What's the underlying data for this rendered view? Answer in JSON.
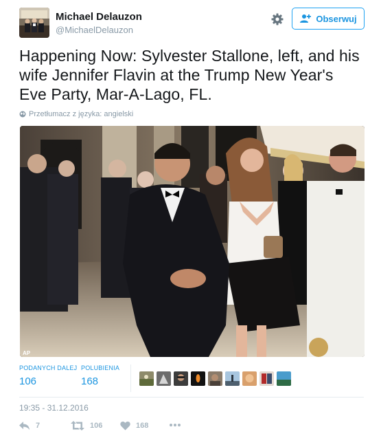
{
  "user": {
    "name": "Michael Delauzon",
    "handle": "@MichaelDelauzon",
    "avatar_icon": "avatar-photo"
  },
  "header": {
    "follow_label": "Obserwuj",
    "follow_icon": "add-user-icon",
    "settings_icon": "gear-icon"
  },
  "tweet": {
    "text": "Happening Now: Sylvester Stallone, left, and his wife Jennifer Flavin at the Trump New Year's Eve Party, Mar-A-Lago, FL.",
    "translate_label": "Przetłumacz z języka: angielski",
    "photo_credit": "AP"
  },
  "stats": {
    "retweets_label": "PODANYCH DALEJ",
    "retweets_value": "106",
    "likes_label": "POLUBIENIA",
    "likes_value": "168",
    "liker_count_shown": 9
  },
  "timestamp": "19:35 - 31.12.2016",
  "actions": {
    "reply_count": "7",
    "retweet_count": "106",
    "like_count": "168",
    "more_icon": "more-icon"
  },
  "colors": {
    "accent": "#1da1f2",
    "link": "#1b95e0",
    "muted": "#8899a6",
    "action_gray": "#aab8c2"
  }
}
